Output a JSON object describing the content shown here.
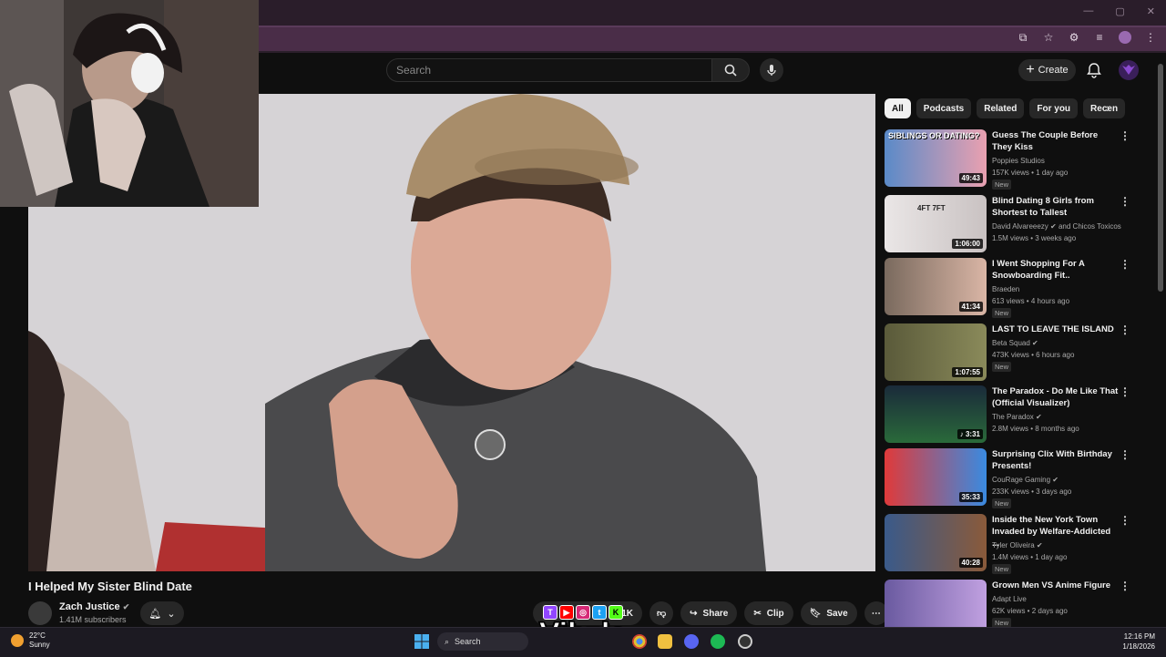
{
  "header": {
    "search_placeholder": "Search",
    "create_label": "Create"
  },
  "video": {
    "title": "I Helped My Sister Blind Date",
    "channel": "Zach Justice",
    "subscribers": "1.41M subscribers",
    "like_count": "1K",
    "share_label": "Share",
    "clip_label": "Clip",
    "save_label": "Save"
  },
  "overlay": {
    "brand": "Vibzlo",
    "social_icons": [
      "twitch-icon",
      "youtube-icon",
      "instagram-icon",
      "twitter-icon",
      "kick-icon"
    ]
  },
  "chips": [
    "All",
    "Podcasts",
    "Related",
    "For you",
    "Recen"
  ],
  "recommendations": [
    {
      "title": "Guess The Couple Before They Kiss",
      "channel": "Poppies Studios",
      "meta": "157K views • 1 day ago",
      "duration": "49:43",
      "badge": "New",
      "verified": false,
      "thumb_text": "SIBLINGS OR DATING?"
    },
    {
      "title": "Blind Dating 8 Girls from Shortest to Tallest",
      "channel": "David Alvareeezy",
      "channel_extra": "and Chicos Toxicos",
      "meta": "1.5M views • 3 weeks ago",
      "duration": "1:06:00",
      "badge": "",
      "verified": true,
      "thumb_text": "4FT 7FT"
    },
    {
      "title": "I Went Shopping For A Snowboarding Fit..",
      "channel": "Braeden",
      "meta": "613 views • 4 hours ago",
      "duration": "41:34",
      "badge": "New",
      "verified": false,
      "thumb_text": ""
    },
    {
      "title": "LAST TO LEAVE THE ISLAND",
      "channel": "Beta Squad",
      "meta": "473K views • 6 hours ago",
      "duration": "1:07:55",
      "badge": "New",
      "verified": true,
      "thumb_text": ""
    },
    {
      "title": "The Paradox - Do Me Like That (Official Visualizer)",
      "channel": "The Paradox",
      "meta": "2.8M views • 8 months ago",
      "duration": "3:31",
      "badge": "",
      "verified": true,
      "thumb_text": ""
    },
    {
      "title": "Surprising Clix With Birthday Presents!",
      "channel": "CouRage Gaming",
      "meta": "233K views • 3 days ago",
      "duration": "35:33",
      "badge": "New",
      "verified": true,
      "thumb_text": ""
    },
    {
      "title": "Inside the New York Town Invaded by Welfare-Addicted ...",
      "channel": "Tyler Oliveira",
      "meta": "1.4M views • 1 day ago",
      "duration": "40:28",
      "badge": "New",
      "verified": true,
      "thumb_text": ""
    },
    {
      "title": "Grown Men VS Anime Figure",
      "channel": "Adapt Live",
      "meta": "62K views • 2 days ago",
      "duration": "",
      "badge": "New",
      "verified": false,
      "thumb_text": ""
    }
  ],
  "taskbar": {
    "temperature": "22°C",
    "weather": "Sunny",
    "search_label": "Search",
    "time": "12:16 PM",
    "date": "1/18/2026"
  },
  "colors": {
    "browser_bg": "#2b1f2b",
    "accent": "#4a2d48",
    "yt_bg": "#0f0f0f"
  }
}
